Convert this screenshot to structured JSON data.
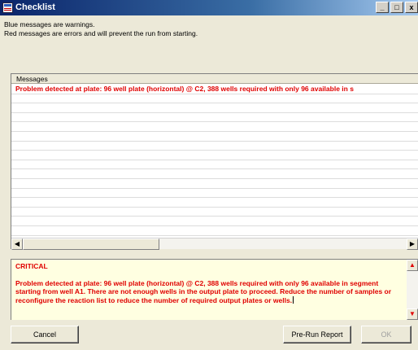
{
  "window": {
    "title": "Checklist",
    "minimize": "_",
    "maximize": "□",
    "close": "x"
  },
  "info": {
    "line1": "Blue messages are warnings.",
    "line2": "Red messages are errors and will prevent the run from starting."
  },
  "messages": {
    "header": "Messages",
    "rows": [
      "Problem detected at plate: 96 well plate (horizontal) @ C2, 388 wells required with only 96 available in s"
    ]
  },
  "scroll": {
    "left": "◀",
    "right": "▶",
    "up": "▲",
    "down": "▼"
  },
  "detail": {
    "title": "CRITICAL",
    "body": "Problem detected at plate: 96 well plate (horizontal) @ C2, 388 wells required with only 96 available in segment starting from well A1. There are not enough wells in the output plate to proceed. Reduce the number of samples or reconfigure the reaction list to reduce the number of required output plates or wells."
  },
  "buttons": {
    "cancel": "Cancel",
    "pre_run_report": "Pre-Run Report",
    "ok": "OK"
  },
  "colors": {
    "error": "#e00000",
    "detail_bg": "#ffffe1"
  }
}
